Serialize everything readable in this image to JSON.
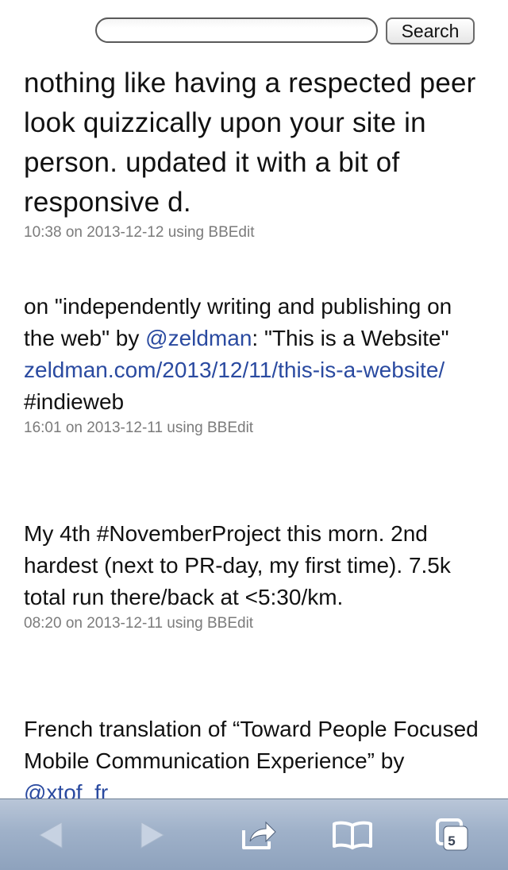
{
  "search": {
    "placeholder": "",
    "value": "",
    "button_label": "Search"
  },
  "posts": [
    {
      "text": "nothing like having a respected peer look quizzically upon your site in person. updated it with a bit of responsive d.",
      "meta": "10:38 on 2013-12-12 using BBEdit"
    },
    {
      "text_1": "on \"independently writing and publishing on the web\" by ",
      "mention": "@zeldman",
      "text_2": ": \"This is a Website\" ",
      "link": "zeldman.com/2013/12/11/this-is-a-website/",
      "text_3": " #indieweb",
      "meta": "16:01 on 2013-12-11 using BBEdit"
    },
    {
      "text": "My 4th #NovemberProject this morn. 2nd hardest (next to PR-day, my first time). 7.5k total run there/back at <5:30/km.",
      "meta": "08:20 on 2013-12-11 using BBEdit"
    },
    {
      "text_1": "French translation of “Toward People Focused Mobile Communication Experience” by ",
      "mention": "@xtof_fr"
    }
  ],
  "toolbar": {
    "tab_count": "5",
    "icons": [
      "back-arrow-icon",
      "forward-arrow-icon",
      "share-icon",
      "bookmarks-icon",
      "tabs-icon"
    ],
    "colors": {
      "bar": "#9fb1c9",
      "icon": "#ffffff",
      "icon_disabled": "#c7d2e2"
    }
  },
  "colors": {
    "link": "#2a4aa0",
    "meta": "#7b7b7b",
    "text": "#111111"
  }
}
